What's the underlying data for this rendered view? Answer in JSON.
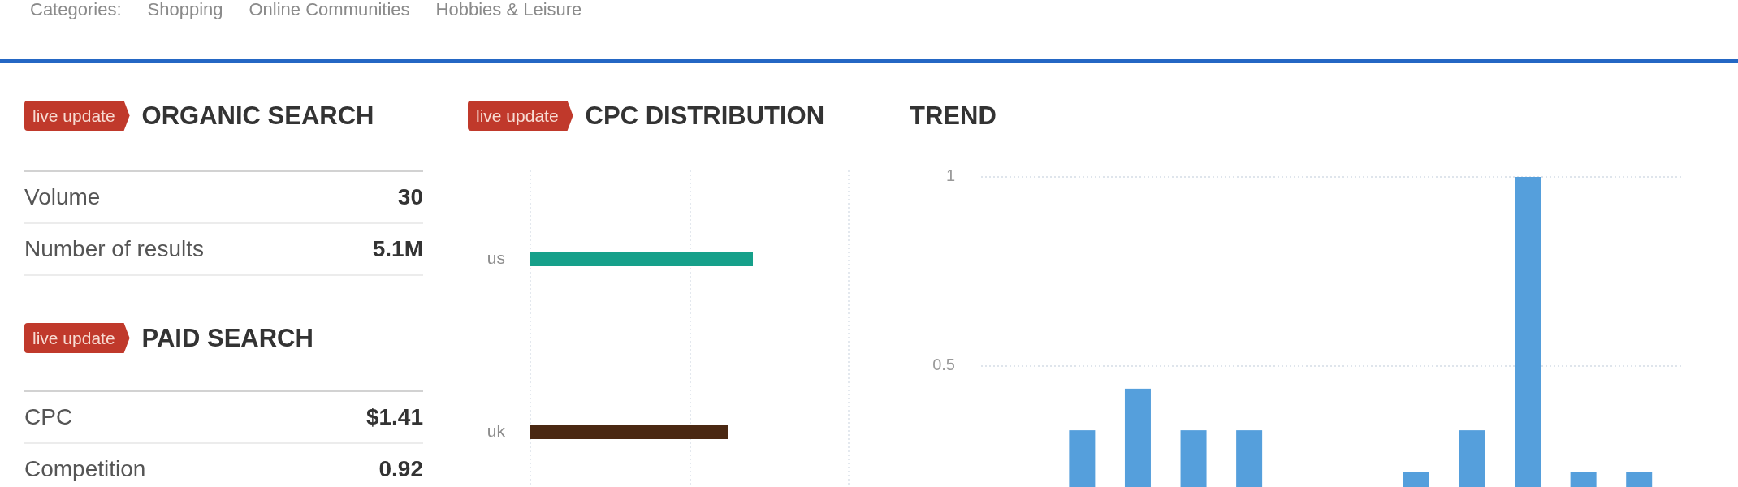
{
  "categories": {
    "label": "Categories:",
    "items": [
      "Shopping",
      "Online Communities",
      "Hobbies & Leisure"
    ]
  },
  "organic_search": {
    "badge": "live update",
    "title": "ORGANIC SEARCH",
    "rows": [
      {
        "label": "Volume",
        "value": "30"
      },
      {
        "label": "Number of results",
        "value": "5.1M"
      }
    ]
  },
  "paid_search": {
    "badge": "live update",
    "title": "PAID SEARCH",
    "rows": [
      {
        "label": "CPC",
        "value": "$1.41"
      },
      {
        "label": "Competition",
        "value": "0.92"
      }
    ]
  },
  "cpc_distribution": {
    "badge": "live update",
    "title": "CPC DISTRIBUTION",
    "bars": [
      {
        "label": "us",
        "color": "#16a08a"
      },
      {
        "label": "uk",
        "color": "#4a2812"
      }
    ]
  },
  "trend": {
    "chart_data": {
      "type": "bar",
      "title": "TREND",
      "values": [
        null,
        0.33,
        0.44,
        0.33,
        0.33,
        null,
        null,
        0.22,
        0.33,
        1,
        0.22,
        0.22
      ],
      "ylim": [
        0.18,
        1
      ],
      "yticks": [
        0.5,
        1
      ]
    }
  }
}
